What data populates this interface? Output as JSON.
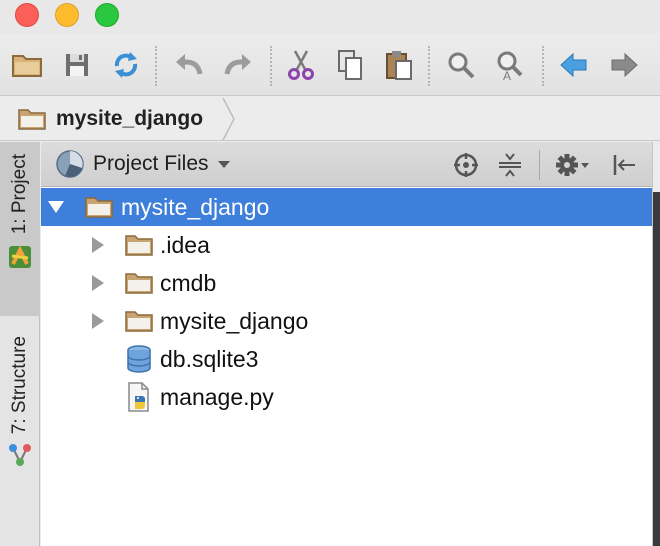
{
  "window": {
    "traffic_lights": {
      "close": "#fc5f57",
      "minimize": "#fdbc2e",
      "maximize": "#29c840"
    }
  },
  "toolbar": {
    "buttons": [
      {
        "name": "open-folder",
        "icon": "folder-icon"
      },
      {
        "name": "save-all",
        "icon": "floppy-disk-icon"
      },
      {
        "name": "synchronize",
        "icon": "sync-icon"
      },
      {
        "name": "undo",
        "icon": "undo-arrow-icon"
      },
      {
        "name": "redo",
        "icon": "redo-arrow-icon"
      },
      {
        "name": "cut",
        "icon": "scissors-icon"
      },
      {
        "name": "copy",
        "icon": "copy-icon"
      },
      {
        "name": "paste",
        "icon": "paste-icon"
      },
      {
        "name": "find",
        "icon": "magnifier-icon"
      },
      {
        "name": "replace",
        "icon": "magnifier-replace-icon"
      },
      {
        "name": "back",
        "icon": "arrow-left-icon"
      },
      {
        "name": "forward",
        "icon": "arrow-right-icon"
      }
    ]
  },
  "navbar": {
    "breadcrumb": "mysite_django"
  },
  "left_strip": {
    "project_tab": "1: Project",
    "structure_tab": "7: Structure"
  },
  "project_panel": {
    "view_mode": "Project Files",
    "tree": [
      {
        "label": "mysite_django",
        "type": "folder",
        "expanded": true,
        "selected": true,
        "depth": 0
      },
      {
        "label": ".idea",
        "type": "folder",
        "expanded": false,
        "depth": 1
      },
      {
        "label": "cmdb",
        "type": "folder",
        "expanded": false,
        "depth": 1
      },
      {
        "label": "mysite_django",
        "type": "folder",
        "expanded": false,
        "depth": 1
      },
      {
        "label": "db.sqlite3",
        "type": "database",
        "depth": 1
      },
      {
        "label": "manage.py",
        "type": "python",
        "depth": 1
      }
    ]
  },
  "colors": {
    "selection": "#3d7fda",
    "folder": "#b9966a",
    "accent_blue": "#3b8fd6"
  }
}
